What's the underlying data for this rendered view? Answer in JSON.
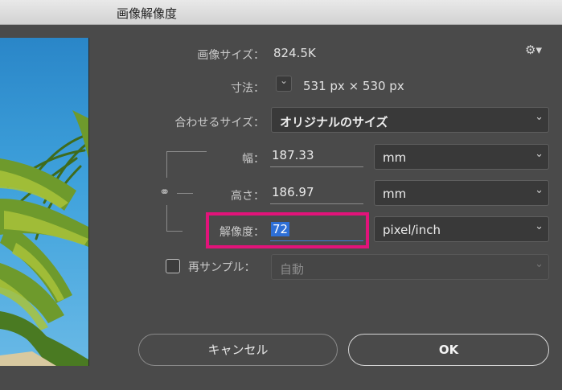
{
  "window": {
    "title": "画像解像度"
  },
  "settings_menu": {
    "icon": "gear-icon",
    "glyph": "⚙▾"
  },
  "image_size": {
    "label": "画像サイズ：",
    "value": "824.5K"
  },
  "dimensions": {
    "label": "寸法：",
    "value": "531 px × 530 px",
    "toggle_glyph": "⌄"
  },
  "fit_to": {
    "label": "合わせるサイズ：",
    "value": "オリジナルのサイズ"
  },
  "width": {
    "label": "幅：",
    "value": "187.33",
    "unit": "mm"
  },
  "height": {
    "label": "高さ：",
    "value": "186.97",
    "unit": "mm"
  },
  "constrain": {
    "icon": "link-icon",
    "glyph": "⚭"
  },
  "resolution": {
    "label": "解像度：",
    "value": "72",
    "unit": "pixel/inch",
    "highlight_color": "#e2137a"
  },
  "resample": {
    "label": "再サンプル：",
    "checked": false,
    "value": "自動"
  },
  "buttons": {
    "cancel": "キャンセル",
    "ok": "OK"
  },
  "chevron_glyph": "⌄",
  "colors": {
    "background": "#4a4a4a",
    "selection": "#2e6fd6"
  }
}
